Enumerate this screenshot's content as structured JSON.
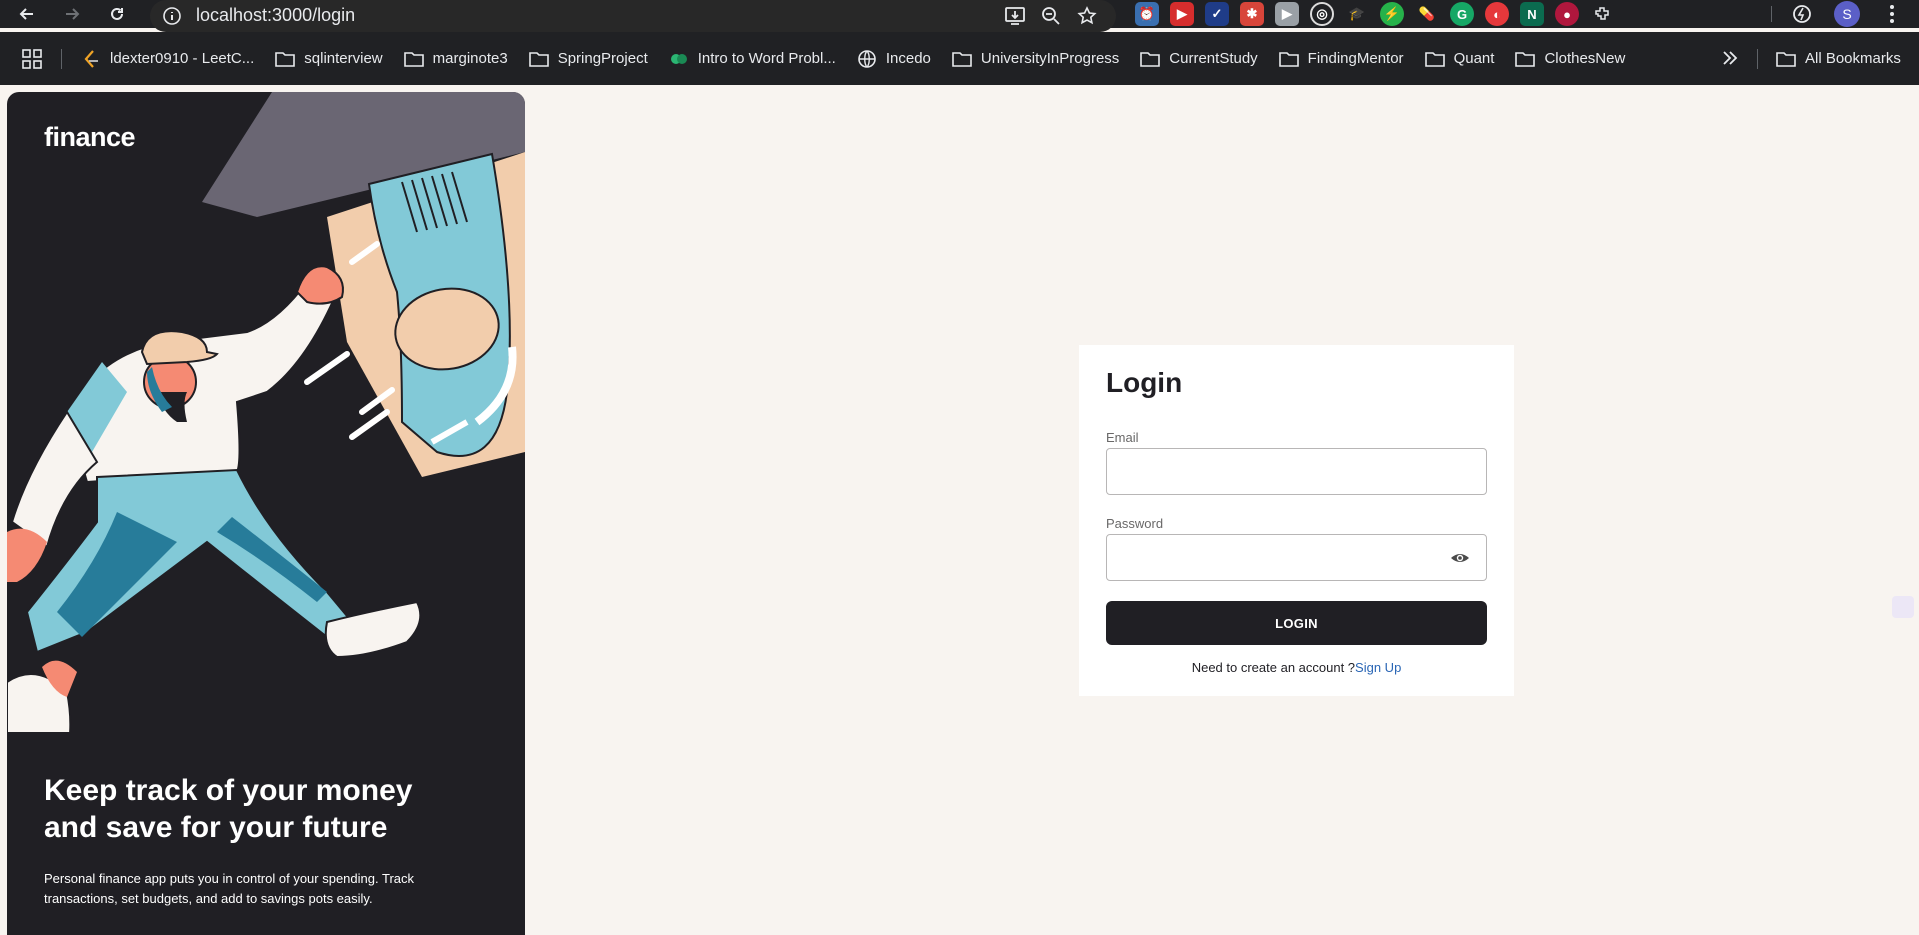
{
  "browser": {
    "url": "localhost:3000/login",
    "profile_initial": "S",
    "bookmarks": [
      {
        "label": "ldexter0910 - LeetC...",
        "icon": "leetcode-icon"
      },
      {
        "label": "sqlinterview",
        "icon": "folder-icon"
      },
      {
        "label": "marginote3",
        "icon": "folder-icon"
      },
      {
        "label": "SpringProject",
        "icon": "folder-icon"
      },
      {
        "label": "Intro to Word Probl...",
        "icon": "green-link-icon"
      },
      {
        "label": "Incedo",
        "icon": "globe-icon"
      },
      {
        "label": "UniversityInProgress",
        "icon": "folder-icon"
      },
      {
        "label": "CurrentStudy",
        "icon": "folder-icon"
      },
      {
        "label": "FindingMentor",
        "icon": "folder-icon"
      },
      {
        "label": "Quant",
        "icon": "folder-icon"
      },
      {
        "label": "ClothesNew",
        "icon": "folder-icon"
      }
    ],
    "all_bookmarks": "All Bookmarks"
  },
  "hero": {
    "brand": "finance",
    "title": "Keep track of your money and save for your future",
    "subtitle": "Personal finance app puts you in control of your spending. Track transactions, set budgets, and add to savings pots easily."
  },
  "login": {
    "title": "Login",
    "email_label": "Email",
    "email_value": "",
    "password_label": "Password",
    "password_value": "",
    "button_label": "LOGIN",
    "signup_prompt": "Need to create an account ?",
    "signup_link": "Sign Up"
  },
  "colors": {
    "page_bg": "#f8f4f0",
    "hero_bg": "#201f24",
    "button_bg": "#201f24",
    "link": "#2a66b5"
  }
}
